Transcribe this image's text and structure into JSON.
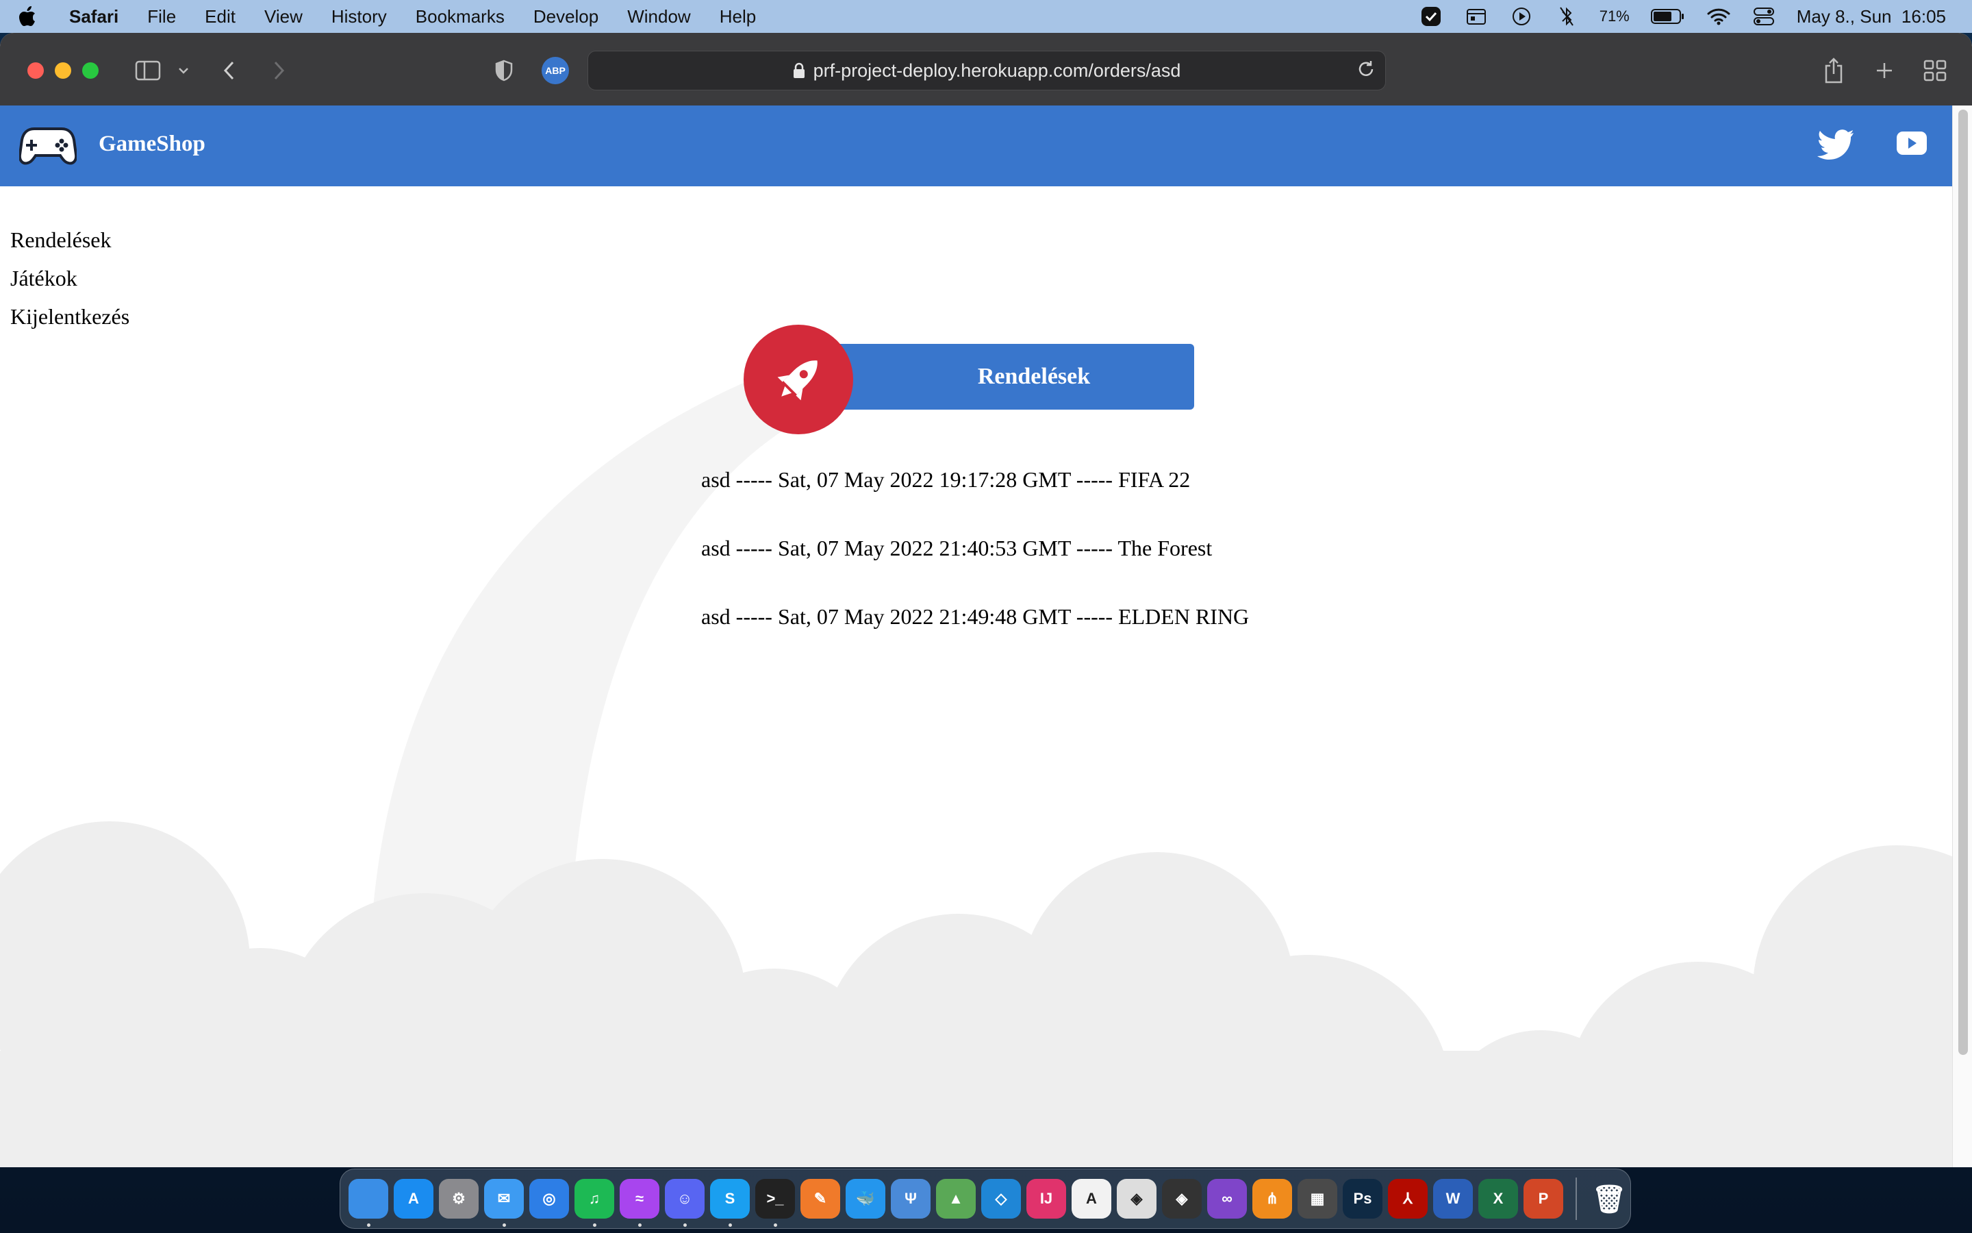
{
  "menubar": {
    "app_name": "Safari",
    "items": [
      "File",
      "Edit",
      "View",
      "History",
      "Bookmarks",
      "Develop",
      "Window",
      "Help"
    ],
    "battery": "71%",
    "datetime": "May 8., Sun  16:05"
  },
  "browser": {
    "url": "prf-project-deploy.herokuapp.com/orders/asd",
    "extension_badge": "ABP"
  },
  "site": {
    "brand": "GameShop",
    "header_color": "#3976cc",
    "accent_red": "#d32a3a",
    "nav": [
      "Rendelések",
      "Játékok",
      "Kijelentkezés"
    ],
    "card_title": "Rendelések",
    "orders": [
      "asd ----- Sat, 07 May 2022 19:17:28 GMT ----- FIFA 22",
      "asd ----- Sat, 07 May 2022 21:40:53 GMT ----- The Forest",
      "asd ----- Sat, 07 May 2022 21:49:48 GMT ----- ELDEN RING"
    ]
  },
  "dock": {
    "apps": [
      {
        "name": "finder",
        "label": "",
        "color": "#3a8ee6"
      },
      {
        "name": "app-store",
        "label": "A",
        "color": "#1a8cf0"
      },
      {
        "name": "system-preferences",
        "label": "⚙",
        "color": "#8a8a8e"
      },
      {
        "name": "mail",
        "label": "✉",
        "color": "#3d9bf2"
      },
      {
        "name": "safari",
        "label": "◎",
        "color": "#2d7ee6"
      },
      {
        "name": "spotify",
        "label": "♫",
        "color": "#1db954"
      },
      {
        "name": "messenger",
        "label": "≈",
        "color": "#a845ee"
      },
      {
        "name": "discord",
        "label": "☺",
        "color": "#5865f2"
      },
      {
        "name": "skype",
        "label": "S",
        "color": "#1a9ff0"
      },
      {
        "name": "terminal",
        "label": ">_",
        "color": "#222222"
      },
      {
        "name": "sketch-pen",
        "label": "✎",
        "color": "#f07a2a"
      },
      {
        "name": "docker",
        "label": "🐳",
        "color": "#2496ed"
      },
      {
        "name": "fork",
        "label": "Ψ",
        "color": "#4a8ad8"
      },
      {
        "name": "android-studio",
        "label": "▲",
        "color": "#5aa856"
      },
      {
        "name": "vscode",
        "label": "◇",
        "color": "#1f86d6"
      },
      {
        "name": "intellij",
        "label": "IJ",
        "color": "#e0336c"
      },
      {
        "name": "ai-app",
        "label": "A",
        "color": "#f2f2f2"
      },
      {
        "name": "unity",
        "label": "◈",
        "color": "#dddddd"
      },
      {
        "name": "unity-hub",
        "label": "◈",
        "color": "#333333"
      },
      {
        "name": "visual-studio",
        "label": "∞",
        "color": "#7f45c9"
      },
      {
        "name": "sourcetree",
        "label": "⋔",
        "color": "#f08b1c"
      },
      {
        "name": "final-cut",
        "label": "▦",
        "color": "#4a4a4a"
      },
      {
        "name": "photoshop",
        "label": "Ps",
        "color": "#0f2a44"
      },
      {
        "name": "acrobat",
        "label": "⅄",
        "color": "#b30b00"
      },
      {
        "name": "word",
        "label": "W",
        "color": "#2b5fb8"
      },
      {
        "name": "excel",
        "label": "X",
        "color": "#1e7145"
      },
      {
        "name": "powerpoint",
        "label": "P",
        "color": "#d24726"
      }
    ],
    "trash_label": "🗑"
  }
}
